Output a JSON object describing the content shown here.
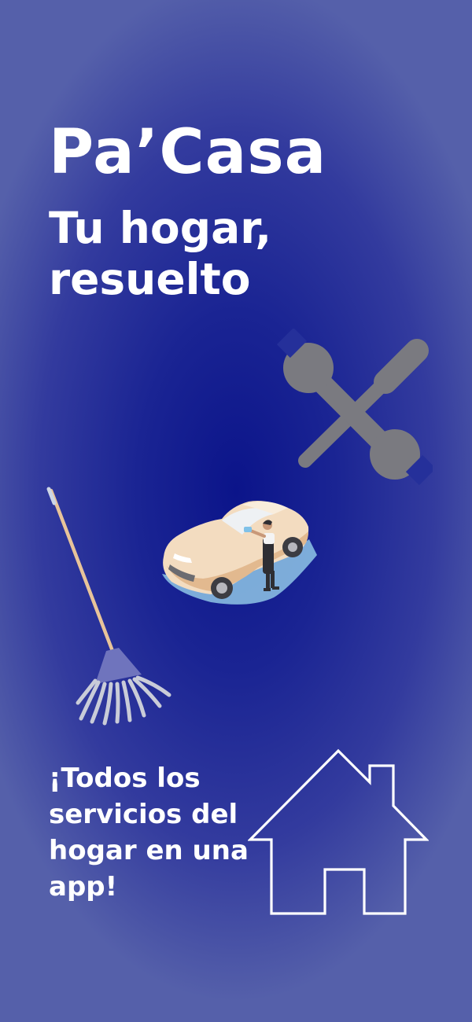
{
  "app": {
    "name": "Pa’Casa",
    "slogan": "Tu hogar, resuelto",
    "tagline": "¡Todos los servicios del hogar en una app!"
  },
  "illustrations": {
    "tools": "wrench-and-screwdriver-icon",
    "mop": "mop-icon",
    "car_wash": "car-wash-illustration",
    "house": "house-outline-icon"
  },
  "colors": {
    "background_center": "#0b148a",
    "background_edge": "#5560aa",
    "text": "#ffffff",
    "tool_gray": "#7a7a80"
  }
}
